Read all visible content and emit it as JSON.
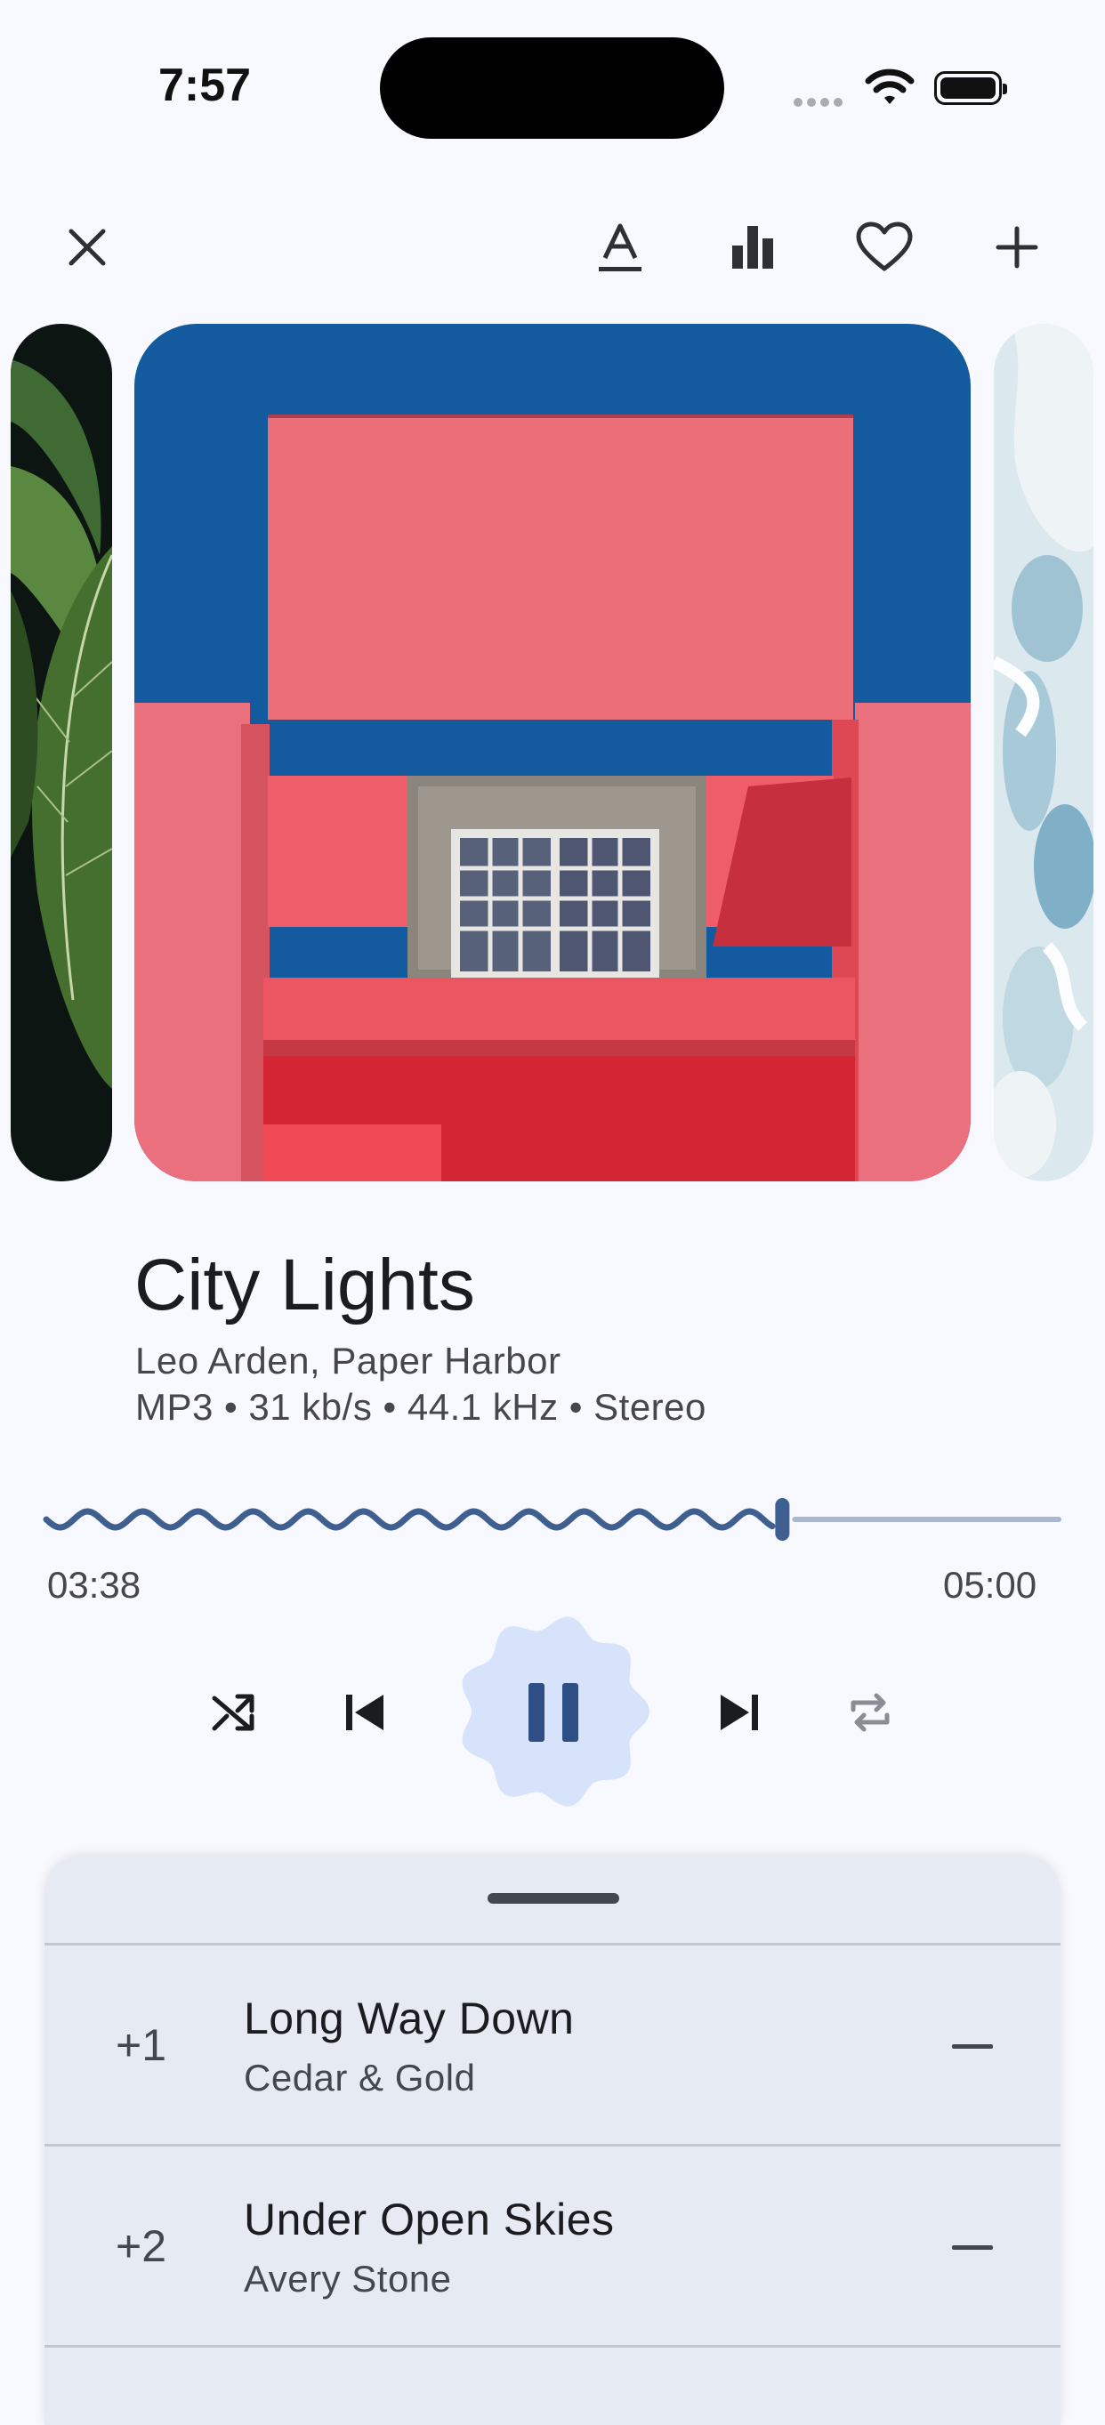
{
  "status_bar": {
    "time": "7:57"
  },
  "track": {
    "title": "City Lights",
    "artists": "Leo Arden, Paper Harbor",
    "details": "MP3 • 31 kb/s • 44.1 kHz • Stereo"
  },
  "progress": {
    "elapsed": "03:38",
    "total": "05:00",
    "fraction": 0.728
  },
  "queue": [
    {
      "offset": "+1",
      "title": "Long Way Down",
      "artist": "Cedar & Gold"
    },
    {
      "offset": "+2",
      "title": "Under Open Skies",
      "artist": "Avery Stone"
    }
  ],
  "colors": {
    "accent": "#3e5f90",
    "accent_track": "#a8b8d0",
    "play_bg": "#d6e3fb",
    "sheet_bg": "#e6eaf2",
    "background": "#f8f9fe"
  },
  "icons": {
    "toolbar": [
      "close-icon",
      "lyrics-icon",
      "equalizer-icon",
      "heart-icon",
      "add-icon"
    ],
    "controls": [
      "shuffle-icon",
      "previous-icon",
      "pause-icon",
      "next-icon",
      "repeat-icon"
    ]
  }
}
